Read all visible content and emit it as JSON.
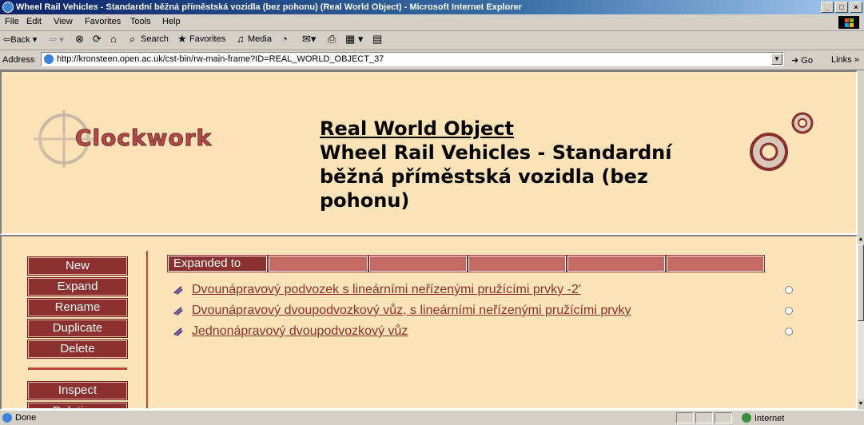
{
  "window": {
    "title": "Wheel Rail Vehicles - Standardní běžná příměstská vozidla (bez pohonu) (Real World Object) - Microsoft Internet Explorer",
    "min_glyph": "_",
    "max_glyph": "□",
    "close_glyph": "×"
  },
  "menubar": {
    "items": [
      "File",
      "Edit",
      "View",
      "Favorites",
      "Tools",
      "Help"
    ]
  },
  "toolbar": {
    "back": "⇦Back ▾",
    "forward": "⇨ ▾",
    "stop": "⊗",
    "refresh": "⟳",
    "home": "⌂",
    "search": "Search",
    "favorites": "Favorites",
    "media": "Media",
    "history": "◔",
    "mail": "✉▾",
    "print": "⎙",
    "edit": "▦ ▾",
    "discuss": "▤"
  },
  "addressbar": {
    "label": "Address",
    "url": "http://kronsteen.open.ac.uk/cst-bin/rw-main-frame?ID=REAL_WORLD_OBJECT_37",
    "go": "Go",
    "links": "Links"
  },
  "header": {
    "logo_text": "Clockwork",
    "kind": "Real World Object",
    "name": "Wheel Rail Vehicles - Standardní běžná příměstská vozidla (bez pohonu)"
  },
  "sidebar": {
    "buttons": [
      "New",
      "Expand",
      "Rename",
      "Duplicate",
      "Delete"
    ],
    "buttons2": [
      "Inspect",
      "Relations"
    ]
  },
  "tabs": {
    "active_label": "Expanded to"
  },
  "expanded_links": [
    "Dvounápravový podvozek s lineárními neřízenými pružícími prvky -2'",
    "Dvounápravový dvoupodvozkový vůz, s lineárními neřízenými pružícími prvky",
    "Jednonápravový dvoupodvozkový vůz"
  ],
  "statusbar": {
    "text": "Done",
    "zone": "Internet"
  },
  "colors": {
    "frame_bg": "#fde3b8",
    "button_bg": "#8b2f2f",
    "tab_bg": "#c46a63",
    "link": "#8b2f2f"
  }
}
